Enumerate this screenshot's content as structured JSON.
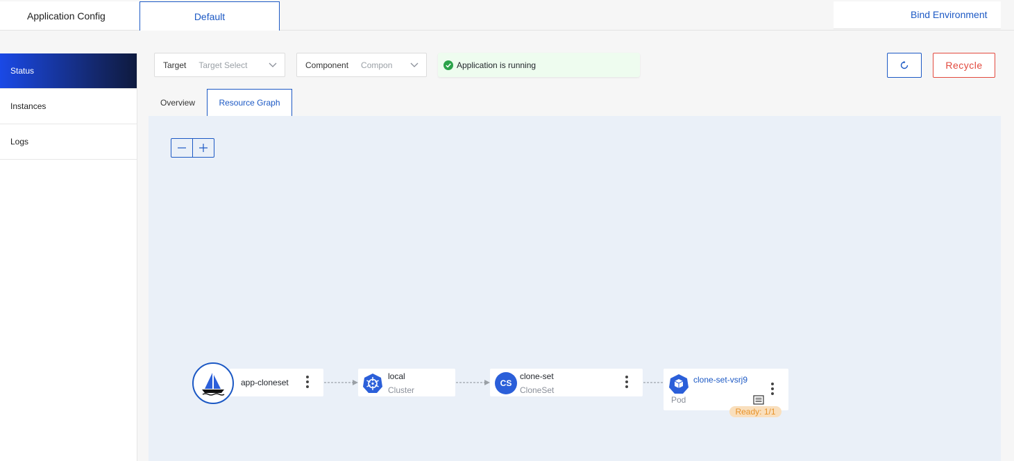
{
  "header": {
    "app_config_label": "Application Config",
    "env_tab_label": "Default",
    "bind_env_label": "Bind Environment"
  },
  "sidebar": {
    "items": [
      {
        "label": "Status",
        "active": true
      },
      {
        "label": "Instances",
        "active": false
      },
      {
        "label": "Logs",
        "active": false
      }
    ]
  },
  "filters": {
    "target": {
      "label": "Target",
      "placeholder": "Target Select"
    },
    "component": {
      "label": "Component",
      "placeholder": "Compon"
    }
  },
  "status": {
    "text": "Application is running",
    "color": "#2ba34a"
  },
  "actions": {
    "refresh_icon": "refresh-icon",
    "recycle_label": "Recycle"
  },
  "tabs": [
    {
      "label": "Overview",
      "active": false
    },
    {
      "label": "Resource Graph",
      "active": true
    }
  ],
  "zoom": {
    "out_icon": "minus-icon",
    "in_icon": "plus-icon"
  },
  "graph": {
    "app": {
      "name": "app-cloneset",
      "icon": "sailboat-icon"
    },
    "cluster": {
      "name": "local",
      "kind": "Cluster",
      "icon": "kubernetes-icon"
    },
    "cloneset": {
      "name": "clone-set",
      "kind": "CloneSet",
      "badge": "CS"
    },
    "pod": {
      "name": "clone-set-vsrj9",
      "kind": "Pod",
      "ready": "Ready: 1/1",
      "icon": "pod-icon"
    }
  },
  "colors": {
    "accent": "#1b58c4",
    "danger": "#e2483d",
    "canvas": "#eaf0f8",
    "ready_bg": "#f9dfbd",
    "ready_text": "#e79229"
  }
}
